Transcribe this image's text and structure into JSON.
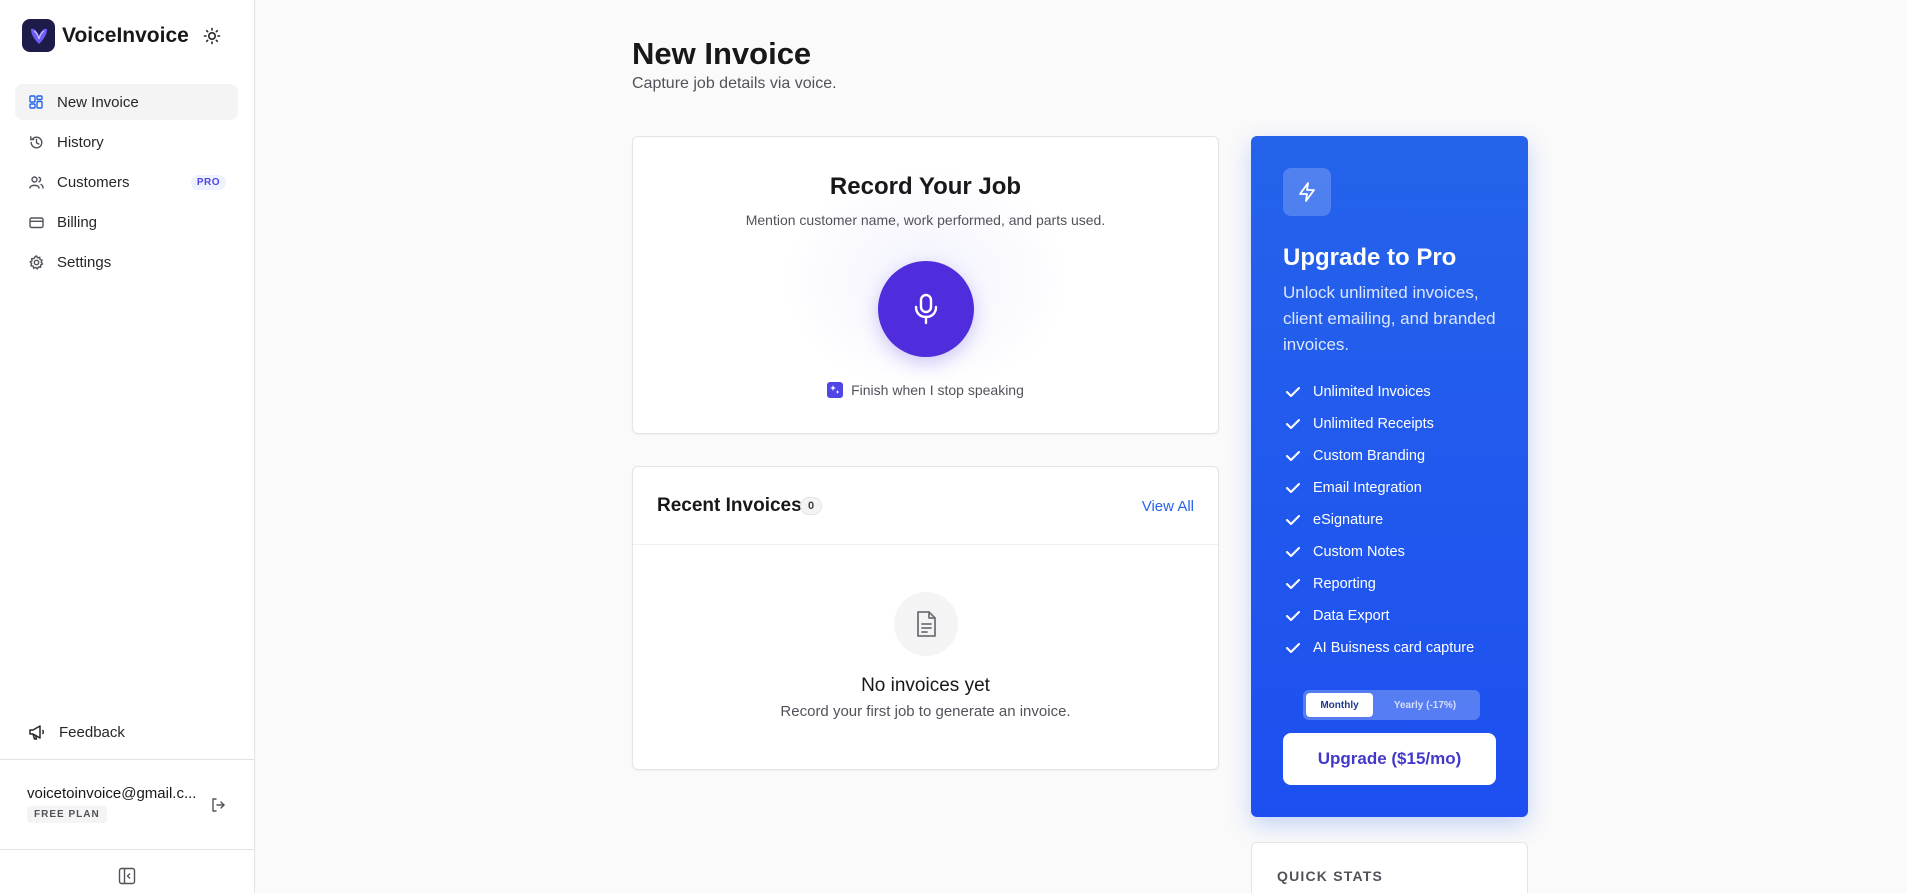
{
  "app": {
    "name": "VoiceInvoice"
  },
  "sidebar": {
    "items": [
      {
        "label": "New Invoice",
        "icon": "grid-icon",
        "active": true
      },
      {
        "label": "History",
        "icon": "history-icon"
      },
      {
        "label": "Customers",
        "icon": "users-icon",
        "badge": "PRO"
      },
      {
        "label": "Billing",
        "icon": "credit-card-icon"
      },
      {
        "label": "Settings",
        "icon": "gear-icon"
      }
    ],
    "feedback_label": "Feedback",
    "user_email": "voicetoinvoice@gmail.c...",
    "plan_label": "FREE PLAN"
  },
  "header": {
    "title": "New Invoice",
    "subtitle": "Capture job details via voice."
  },
  "record": {
    "title": "Record Your Job",
    "subtitle": "Mention customer name, work performed, and parts used.",
    "auto_finish_label": "Finish when I stop speaking",
    "auto_finish_checked": true
  },
  "recent": {
    "title": "Recent Invoices",
    "count": "0",
    "view_all_label": "View All",
    "empty_title": "No invoices yet",
    "empty_subtitle": "Record your first job to generate an invoice."
  },
  "upgrade": {
    "title": "Upgrade to Pro",
    "description": "Unlock unlimited invoices, client emailing, and branded invoices.",
    "features": [
      "Unlimited Invoices",
      "Unlimited Receipts",
      "Custom Branding",
      "Email Integration",
      "eSignature",
      "Custom Notes",
      "Reporting",
      "Data Export",
      "AI Buisness card capture"
    ],
    "billing_options": {
      "monthly": "Monthly",
      "yearly": "Yearly (-17%)",
      "selected": "Monthly"
    },
    "button_label": "Upgrade ($15/mo)"
  },
  "stats": {
    "title": "QUICK STATS"
  },
  "colors": {
    "accent": "#4f2ddc",
    "upgrade_bg": "#2563eb",
    "link": "#2563eb"
  }
}
